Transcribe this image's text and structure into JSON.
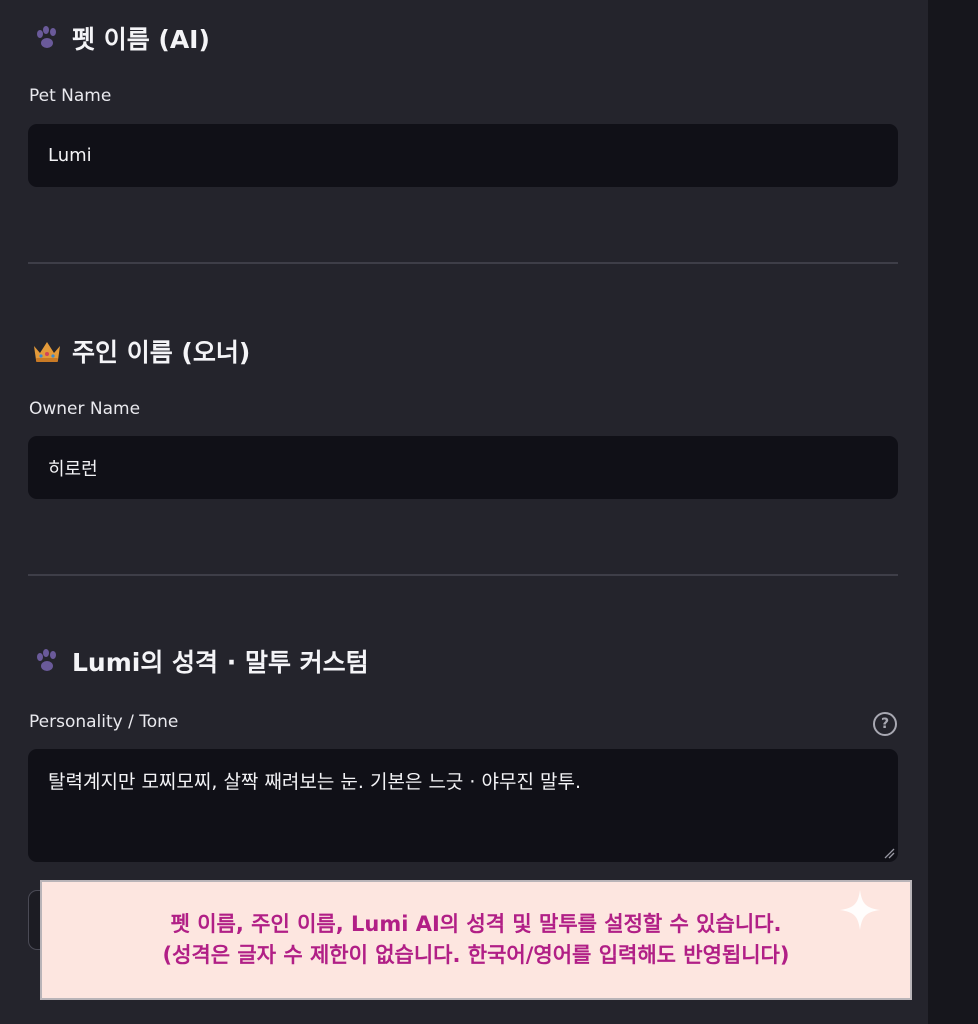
{
  "sections": {
    "pet": {
      "title": "펫 이름 (AI)",
      "label": "Pet Name",
      "value": "Lumi"
    },
    "owner": {
      "title": "주인 이름 (오너)",
      "label": "Owner Name",
      "value": "히로런"
    },
    "personality": {
      "title": "Lumi의 성격 · 말투 커스텀",
      "label": "Personality / Tone",
      "value": "탈력계지만 모찌모찌, 살짝 째려보는 눈. 기본은 느긋 · 야무진 말투.",
      "help": "?"
    }
  },
  "banner": {
    "line1": "펫 이름, 주인 이름, Lumi AI의 성격 및 말투를 설정할 수 있습니다.",
    "line2": "(성격은 글자 수 제한이 없습니다. 한국어/영어를 입력해도 반영됩니다)"
  },
  "icons": {
    "pet": "paw-icon",
    "owner": "crown-icon",
    "personality": "paw-icon",
    "banner_decoration": "sparkle-icon"
  },
  "colors": {
    "background": "#24242c",
    "input": "#101017",
    "banner_bg": "#fde6e0",
    "banner_text": "#b11f86",
    "paw": "#6a5a9a",
    "crown": "#e39a3a"
  }
}
